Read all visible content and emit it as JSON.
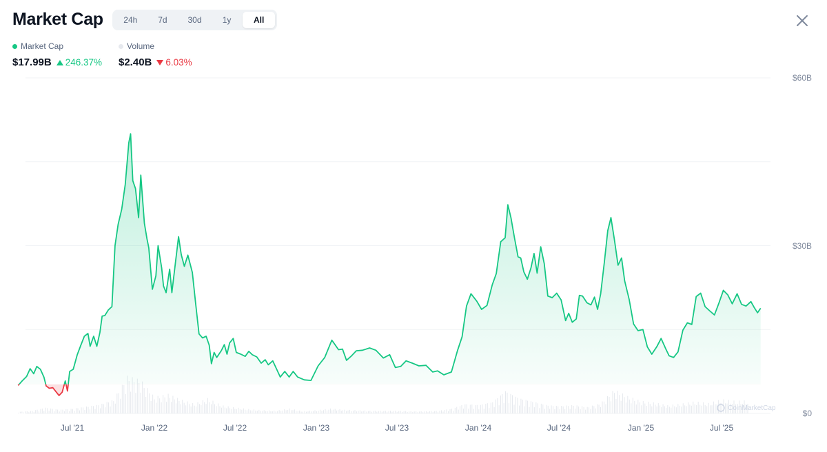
{
  "header": {
    "title": "Market Cap",
    "tabs": [
      "24h",
      "7d",
      "30d",
      "1y",
      "All"
    ],
    "active_tab": "All"
  },
  "legend": {
    "market_cap": {
      "label": "Market Cap",
      "value": "$17.99B",
      "change": "246.37%",
      "direction": "up",
      "color": "#16c784"
    },
    "volume": {
      "label": "Volume",
      "value": "$2.40B",
      "change": "6.03%",
      "direction": "down",
      "color": "#e6e9ee"
    }
  },
  "watermark": "CoinMarketCap",
  "chart_data": {
    "type": "area",
    "title": "",
    "xlabel": "",
    "ylabel": "",
    "y_axis_position": "right",
    "ylim": [
      0,
      60
    ],
    "y_ticks": [
      "$60B",
      "$30B",
      "$0"
    ],
    "x_ticks": [
      "Jul '21",
      "Jan '22",
      "Jul '22",
      "Jan '23",
      "Jul '23",
      "Jan '24",
      "Jul '24",
      "Jan '25",
      "Jul '25"
    ],
    "grid": true,
    "baseline": 5.2,
    "colors": {
      "above": "#16c784",
      "below": "#ea3943"
    },
    "series": [
      {
        "name": "Market Cap",
        "points": [
          [
            "2021-03-01",
            5.0
          ],
          [
            "2021-03-10",
            5.8
          ],
          [
            "2021-03-20",
            6.6
          ],
          [
            "2021-03-28",
            8.0
          ],
          [
            "2021-04-05",
            7.1
          ],
          [
            "2021-04-12",
            8.4
          ],
          [
            "2021-04-20",
            7.9
          ],
          [
            "2021-04-28",
            6.5
          ],
          [
            "2021-05-03",
            4.9
          ],
          [
            "2021-05-10",
            4.5
          ],
          [
            "2021-05-18",
            4.6
          ],
          [
            "2021-05-25",
            3.9
          ],
          [
            "2021-06-01",
            3.2
          ],
          [
            "2021-06-08",
            3.8
          ],
          [
            "2021-06-15",
            5.8
          ],
          [
            "2021-06-20",
            4.0
          ],
          [
            "2021-06-25",
            7.5
          ],
          [
            "2021-07-03",
            7.9
          ],
          [
            "2021-07-12",
            10.5
          ],
          [
            "2021-07-20",
            12.2
          ],
          [
            "2021-07-28",
            13.8
          ],
          [
            "2021-08-05",
            14.3
          ],
          [
            "2021-08-10",
            12.0
          ],
          [
            "2021-08-18",
            13.8
          ],
          [
            "2021-08-25",
            12.0
          ],
          [
            "2021-09-01",
            14.5
          ],
          [
            "2021-09-06",
            17.4
          ],
          [
            "2021-09-12",
            17.5
          ],
          [
            "2021-09-20",
            18.5
          ],
          [
            "2021-09-28",
            19.1
          ],
          [
            "2021-10-05",
            30.0
          ],
          [
            "2021-10-12",
            33.8
          ],
          [
            "2021-10-20",
            36.5
          ],
          [
            "2021-10-28",
            40.9
          ],
          [
            "2021-11-05",
            48.4
          ],
          [
            "2021-11-09",
            50.0
          ],
          [
            "2021-11-14",
            41.6
          ],
          [
            "2021-11-20",
            40.2
          ],
          [
            "2021-11-27",
            35.0
          ],
          [
            "2021-12-02",
            42.6
          ],
          [
            "2021-12-10",
            34.0
          ],
          [
            "2021-12-16",
            31.2
          ],
          [
            "2021-12-20",
            29.6
          ],
          [
            "2021-12-28",
            22.2
          ],
          [
            "2022-01-05",
            24.6
          ],
          [
            "2022-01-10",
            30.0
          ],
          [
            "2022-01-18",
            26.0
          ],
          [
            "2022-01-22",
            22.8
          ],
          [
            "2022-01-28",
            21.6
          ],
          [
            "2022-02-05",
            25.8
          ],
          [
            "2022-02-10",
            21.6
          ],
          [
            "2022-02-18",
            27.0
          ],
          [
            "2022-02-25",
            31.6
          ],
          [
            "2022-03-03",
            28.4
          ],
          [
            "2022-03-10",
            26.3
          ],
          [
            "2022-03-18",
            28.3
          ],
          [
            "2022-03-28",
            25.2
          ],
          [
            "2022-04-05",
            19.3
          ],
          [
            "2022-04-12",
            14.2
          ],
          [
            "2022-04-20",
            13.5
          ],
          [
            "2022-04-28",
            13.8
          ],
          [
            "2022-05-05",
            12.2
          ],
          [
            "2022-05-10",
            8.9
          ],
          [
            "2022-05-16",
            10.9
          ],
          [
            "2022-05-22",
            10.0
          ],
          [
            "2022-06-01",
            11.2
          ],
          [
            "2022-06-08",
            12.3
          ],
          [
            "2022-06-14",
            10.6
          ],
          [
            "2022-06-20",
            12.6
          ],
          [
            "2022-06-28",
            13.4
          ],
          [
            "2022-07-05",
            10.9
          ],
          [
            "2022-07-15",
            10.6
          ],
          [
            "2022-07-25",
            10.2
          ],
          [
            "2022-08-02",
            11.1
          ],
          [
            "2022-08-10",
            10.5
          ],
          [
            "2022-08-20",
            10.1
          ],
          [
            "2022-08-30",
            9.0
          ],
          [
            "2022-09-08",
            9.6
          ],
          [
            "2022-09-15",
            8.7
          ],
          [
            "2022-09-25",
            9.4
          ],
          [
            "2022-10-05",
            7.7
          ],
          [
            "2022-10-12",
            6.5
          ],
          [
            "2022-10-22",
            7.5
          ],
          [
            "2022-11-01",
            6.5
          ],
          [
            "2022-11-10",
            7.5
          ],
          [
            "2022-11-20",
            6.5
          ],
          [
            "2022-12-05",
            6.0
          ],
          [
            "2022-12-20",
            5.9
          ],
          [
            "2023-01-05",
            8.5
          ],
          [
            "2023-01-20",
            10.0
          ],
          [
            "2023-02-05",
            13.1
          ],
          [
            "2023-02-12",
            12.3
          ],
          [
            "2023-02-20",
            11.4
          ],
          [
            "2023-03-01",
            11.5
          ],
          [
            "2023-03-10",
            9.5
          ],
          [
            "2023-03-20",
            10.2
          ],
          [
            "2023-04-01",
            11.2
          ],
          [
            "2023-04-15",
            11.3
          ],
          [
            "2023-05-01",
            11.7
          ],
          [
            "2023-05-15",
            11.3
          ],
          [
            "2023-06-01",
            9.9
          ],
          [
            "2023-06-15",
            10.5
          ],
          [
            "2023-06-28",
            8.2
          ],
          [
            "2023-07-10",
            8.4
          ],
          [
            "2023-07-22",
            9.4
          ],
          [
            "2023-08-05",
            9.0
          ],
          [
            "2023-08-20",
            8.5
          ],
          [
            "2023-09-05",
            8.6
          ],
          [
            "2023-09-20",
            7.4
          ],
          [
            "2023-10-01",
            7.6
          ],
          [
            "2023-10-15",
            6.9
          ],
          [
            "2023-11-01",
            7.4
          ],
          [
            "2023-11-15",
            11.3
          ],
          [
            "2023-11-25",
            13.7
          ],
          [
            "2023-12-05",
            19.2
          ],
          [
            "2023-12-15",
            21.4
          ],
          [
            "2023-12-28",
            20.1
          ],
          [
            "2024-01-08",
            18.6
          ],
          [
            "2024-01-20",
            19.3
          ],
          [
            "2024-02-01",
            23.0
          ],
          [
            "2024-02-10",
            25.0
          ],
          [
            "2024-02-20",
            30.7
          ],
          [
            "2024-03-01",
            31.4
          ],
          [
            "2024-03-07",
            37.3
          ],
          [
            "2024-03-14",
            35.0
          ],
          [
            "2024-03-22",
            31.4
          ],
          [
            "2024-03-30",
            28.0
          ],
          [
            "2024-04-05",
            27.8
          ],
          [
            "2024-04-12",
            25.3
          ],
          [
            "2024-04-20",
            24.0
          ],
          [
            "2024-04-28",
            26.0
          ],
          [
            "2024-05-05",
            28.6
          ],
          [
            "2024-05-12",
            25.1
          ],
          [
            "2024-05-20",
            29.8
          ],
          [
            "2024-05-28",
            26.8
          ],
          [
            "2024-06-05",
            21.0
          ],
          [
            "2024-06-15",
            20.7
          ],
          [
            "2024-06-25",
            21.5
          ],
          [
            "2024-07-05",
            20.3
          ],
          [
            "2024-07-15",
            16.6
          ],
          [
            "2024-07-22",
            17.9
          ],
          [
            "2024-07-30",
            16.3
          ],
          [
            "2024-08-08",
            16.9
          ],
          [
            "2024-08-15",
            21.1
          ],
          [
            "2024-08-22",
            21.0
          ],
          [
            "2024-09-01",
            19.8
          ],
          [
            "2024-09-10",
            19.4
          ],
          [
            "2024-09-18",
            20.8
          ],
          [
            "2024-09-25",
            18.6
          ],
          [
            "2024-10-02",
            21.4
          ],
          [
            "2024-10-10",
            26.9
          ],
          [
            "2024-10-18",
            32.7
          ],
          [
            "2024-10-25",
            35.0
          ],
          [
            "2024-11-02",
            31.0
          ],
          [
            "2024-11-10",
            26.5
          ],
          [
            "2024-11-18",
            27.8
          ],
          [
            "2024-11-25",
            23.7
          ],
          [
            "2024-12-05",
            20.4
          ],
          [
            "2024-12-15",
            16.0
          ],
          [
            "2024-12-25",
            14.8
          ],
          [
            "2025-01-05",
            15.0
          ],
          [
            "2025-01-15",
            11.9
          ],
          [
            "2025-01-25",
            10.6
          ],
          [
            "2025-02-05",
            11.9
          ],
          [
            "2025-02-15",
            13.4
          ],
          [
            "2025-02-25",
            11.6
          ],
          [
            "2025-03-05",
            10.3
          ],
          [
            "2025-03-15",
            10.0
          ],
          [
            "2025-03-25",
            11.0
          ],
          [
            "2025-04-05",
            14.9
          ],
          [
            "2025-04-15",
            16.2
          ],
          [
            "2025-04-25",
            15.9
          ],
          [
            "2025-05-05",
            20.9
          ],
          [
            "2025-05-15",
            21.5
          ],
          [
            "2025-05-25",
            19.1
          ],
          [
            "2025-06-05",
            18.3
          ],
          [
            "2025-06-15",
            17.6
          ],
          [
            "2025-06-25",
            19.7
          ],
          [
            "2025-07-05",
            22.0
          ],
          [
            "2025-07-15",
            21.2
          ],
          [
            "2025-07-25",
            19.6
          ],
          [
            "2025-08-05",
            21.4
          ],
          [
            "2025-08-15",
            19.5
          ],
          [
            "2025-08-25",
            19.2
          ],
          [
            "2025-09-05",
            20.0
          ],
          [
            "2025-09-12",
            19.0
          ],
          [
            "2025-09-20",
            18.0
          ],
          [
            "2025-09-27",
            18.8
          ]
        ]
      },
      {
        "name": "Volume",
        "points": [
          [
            "2021-03-01",
            0.3
          ],
          [
            "2021-04-01",
            0.5
          ],
          [
            "2021-05-01",
            1.1
          ],
          [
            "2021-06-01",
            0.7
          ],
          [
            "2021-07-01",
            0.9
          ],
          [
            "2021-08-01",
            1.3
          ],
          [
            "2021-09-01",
            1.7
          ],
          [
            "2021-10-01",
            2.6
          ],
          [
            "2021-11-01",
            7.0
          ],
          [
            "2021-12-01",
            6.3
          ],
          [
            "2022-01-01",
            3.1
          ],
          [
            "2022-02-01",
            3.6
          ],
          [
            "2022-03-01",
            2.6
          ],
          [
            "2022-04-01",
            1.8
          ],
          [
            "2022-05-01",
            2.8
          ],
          [
            "2022-06-01",
            1.5
          ],
          [
            "2022-07-01",
            1.1
          ],
          [
            "2022-08-01",
            0.8
          ],
          [
            "2022-09-01",
            0.6
          ],
          [
            "2022-10-01",
            0.5
          ],
          [
            "2022-11-01",
            0.9
          ],
          [
            "2022-12-01",
            0.4
          ],
          [
            "2023-01-01",
            0.6
          ],
          [
            "2023-02-01",
            0.9
          ],
          [
            "2023-03-01",
            0.7
          ],
          [
            "2023-04-01",
            0.6
          ],
          [
            "2023-05-01",
            0.5
          ],
          [
            "2023-06-01",
            0.5
          ],
          [
            "2023-07-01",
            0.5
          ],
          [
            "2023-08-01",
            0.4
          ],
          [
            "2023-09-01",
            0.4
          ],
          [
            "2023-10-01",
            0.5
          ],
          [
            "2023-11-01",
            0.9
          ],
          [
            "2023-12-01",
            1.8
          ],
          [
            "2024-01-01",
            1.6
          ],
          [
            "2024-02-01",
            2.2
          ],
          [
            "2024-03-01",
            4.3
          ],
          [
            "2024-04-01",
            2.9
          ],
          [
            "2024-05-01",
            2.3
          ],
          [
            "2024-06-01",
            1.6
          ],
          [
            "2024-07-01",
            1.4
          ],
          [
            "2024-08-01",
            1.6
          ],
          [
            "2024-09-01",
            1.2
          ],
          [
            "2024-10-01",
            1.9
          ],
          [
            "2024-11-01",
            4.5
          ],
          [
            "2024-12-01",
            3.2
          ],
          [
            "2025-01-01",
            2.3
          ],
          [
            "2025-02-01",
            2.0
          ],
          [
            "2025-03-01",
            1.5
          ],
          [
            "2025-04-01",
            1.8
          ],
          [
            "2025-05-01",
            2.2
          ],
          [
            "2025-06-01",
            1.9
          ],
          [
            "2025-07-01",
            2.6
          ],
          [
            "2025-08-01",
            2.3
          ],
          [
            "2025-09-01",
            2.4
          ]
        ]
      }
    ]
  }
}
